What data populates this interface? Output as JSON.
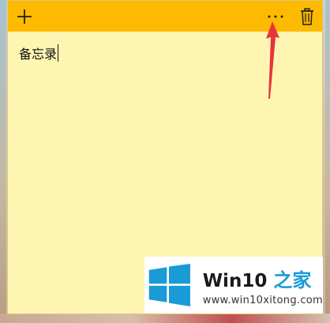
{
  "note": {
    "content": "备忘录"
  },
  "toolbar": {
    "add_icon": "plus-icon",
    "more_icon": "more-dots-icon",
    "delete_icon": "trash-icon"
  },
  "watermark": {
    "brand": "Win10",
    "brand_cn": "之家",
    "url": "www.win10xitong.com"
  },
  "colors": {
    "titlebar": "#fdba00",
    "note_background": "#fff5b3",
    "annotation_arrow": "#e8333a",
    "logo_blue": "#1a9ad6"
  }
}
